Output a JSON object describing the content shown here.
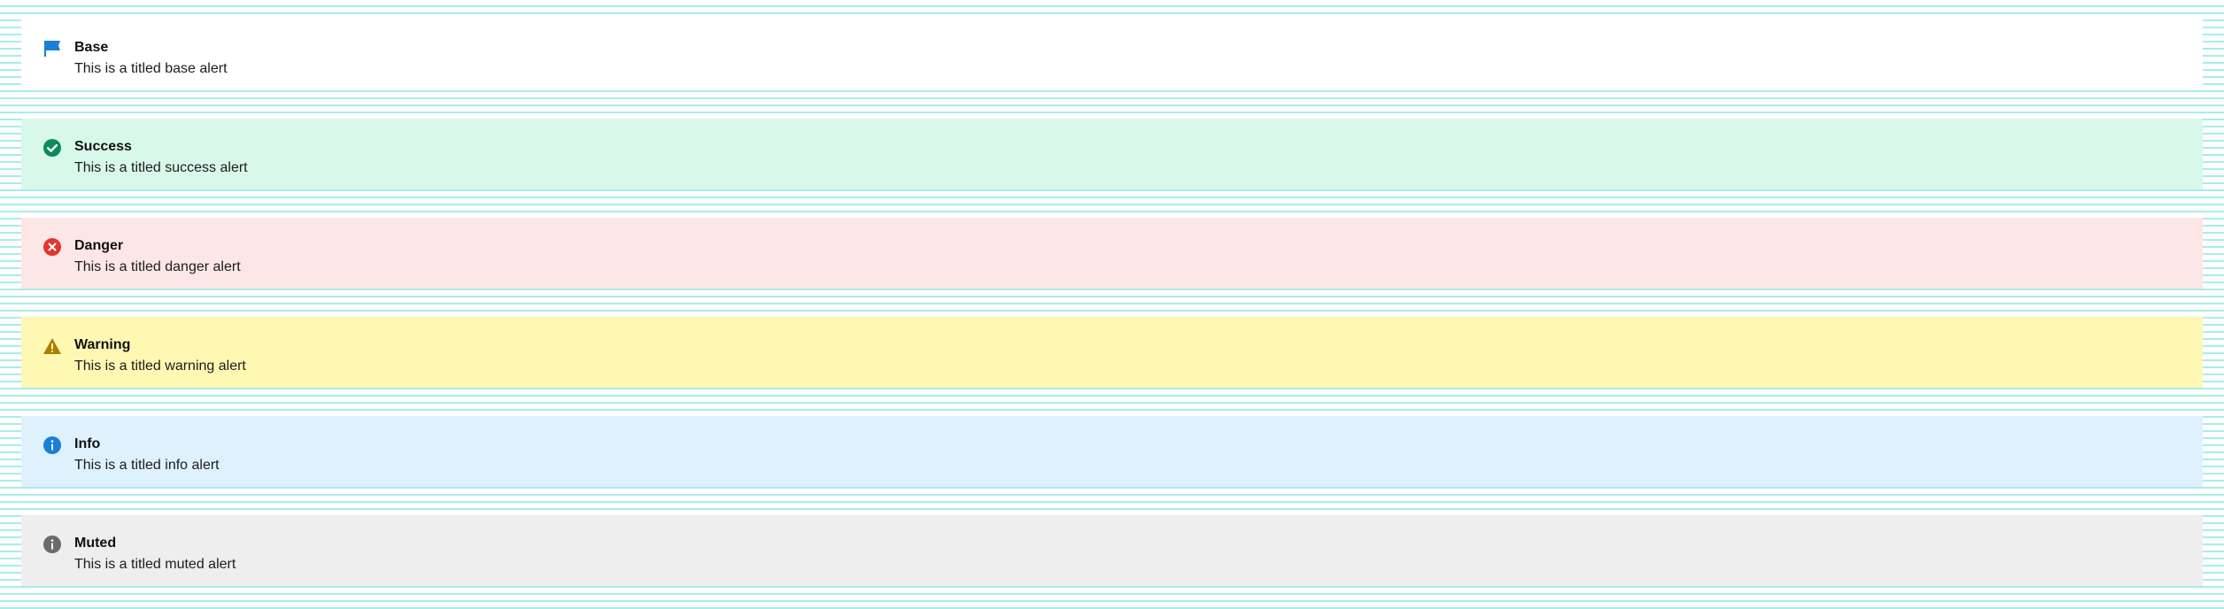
{
  "alerts": [
    {
      "variant": "base",
      "icon": "flag-icon",
      "title": "Base",
      "message": "This is a titled base alert",
      "icon_color": "#1a7fd6"
    },
    {
      "variant": "success",
      "icon": "check-circle-icon",
      "title": "Success",
      "message": "This is a titled success alert",
      "icon_color": "#0f8a5f"
    },
    {
      "variant": "danger",
      "icon": "x-circle-icon",
      "title": "Danger",
      "message": "This is a titled danger alert",
      "icon_color": "#e0372e"
    },
    {
      "variant": "warning",
      "icon": "warning-triangle-icon",
      "title": "Warning",
      "message": "This is a titled warning alert",
      "icon_color": "#b07b00"
    },
    {
      "variant": "info",
      "icon": "info-circle-icon",
      "title": "Info",
      "message": "This is a titled info alert",
      "icon_color": "#1a7fd6"
    },
    {
      "variant": "muted",
      "icon": "info-circle-icon",
      "title": "Muted",
      "message": "This is a titled muted alert",
      "icon_color": "#6b6b6b"
    }
  ],
  "colors": {
    "base_bg": "#ffffff",
    "success_bg": "#d7f8ea",
    "danger_bg": "#fde7e6",
    "warning_bg": "#fff8b3",
    "info_bg": "#dff1fd",
    "muted_bg": "#efeeef",
    "grid_line": "#a9ecec"
  }
}
